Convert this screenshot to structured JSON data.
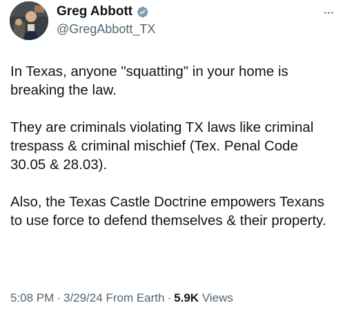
{
  "author": {
    "display_name": "Greg Abbott",
    "handle": "@GregAbbott_TX",
    "verified": true,
    "verified_color": "#829aab"
  },
  "tweet": {
    "paragraphs": [
      "In Texas, anyone \"squatting\" in your home is breaking the law.",
      "They are criminals violating TX laws like criminal trespass & criminal mischief (Tex. Penal Code 30.05 & 28.03).",
      "Also, the Texas Castle Doctrine empowers Texans to use force to defend themselves & their property."
    ]
  },
  "meta": {
    "time": "5:08 PM",
    "separator": "·",
    "date": "3/29/24",
    "source": "From Earth",
    "views_count": "5.9K",
    "views_label": "Views"
  },
  "icons": {
    "avatar": "profile-photo",
    "verified": "verified-badge-icon",
    "more": "more-options-icon"
  },
  "colors": {
    "text_primary": "#0f1419",
    "text_secondary": "#536471",
    "background": "#ffffff"
  }
}
